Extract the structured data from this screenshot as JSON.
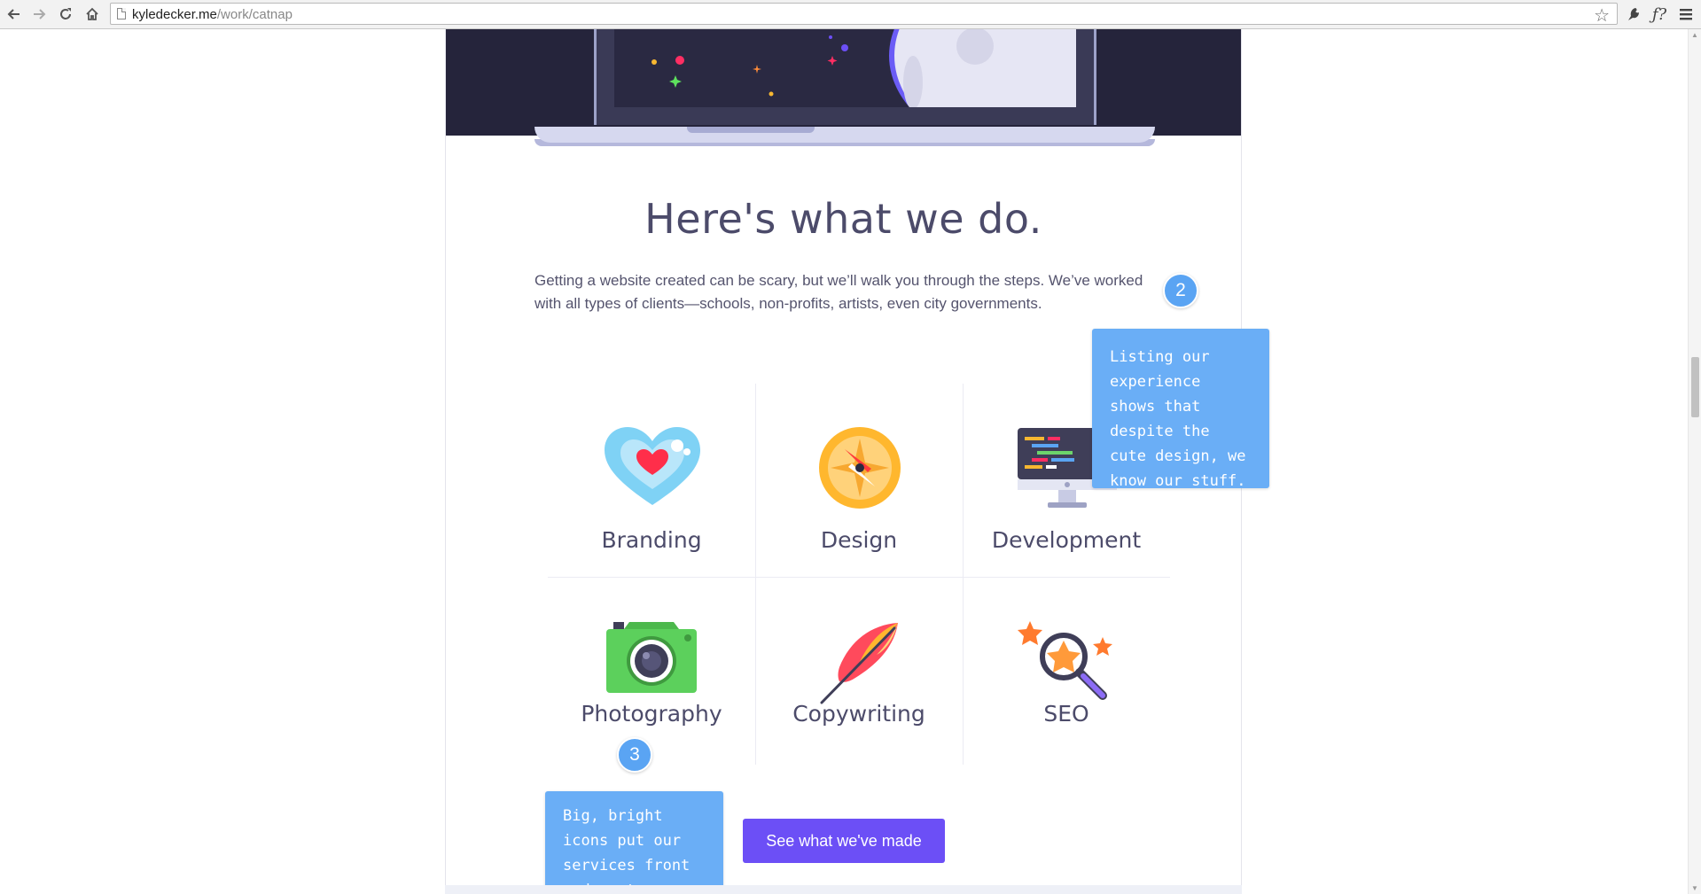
{
  "browser": {
    "url_host": "kyledecker.me",
    "url_path": "/work/catnap",
    "back_icon": "arrow-left",
    "forward_icon": "arrow-right",
    "reload_icon": "reload",
    "home_icon": "home",
    "bookmark_icon": "star",
    "ext1_icon": "gear-bird",
    "ext2_label": "ƒ?",
    "menu_icon": "hamburger"
  },
  "page": {
    "heading": "Here's what we do.",
    "intro": "Getting a website created can be scary, but we’ll walk you through the steps. We’ve worked with all types of clients—schools, non-profits, artists, even city governments.",
    "services": [
      {
        "label": "Branding",
        "icon": "heart-icon"
      },
      {
        "label": "Design",
        "icon": "compass-icon"
      },
      {
        "label": "Development",
        "icon": "monitor-icon"
      },
      {
        "label": "Photography",
        "icon": "camera-icon"
      },
      {
        "label": "Copywriting",
        "icon": "feather-icon"
      },
      {
        "label": "SEO",
        "icon": "magnifier-icon"
      }
    ],
    "cta_label": "See what we've made"
  },
  "annotations": [
    {
      "number": "2",
      "text": "Listing our experience shows that despite the cute design, we know our stuff."
    },
    {
      "number": "3",
      "text": "Big, bright icons put our services front and center."
    }
  ],
  "colors": {
    "hero_bg": "#25243b",
    "accent": "#6c4ff6",
    "annotation": "#6aaef6",
    "heading": "#4c4b6a"
  }
}
